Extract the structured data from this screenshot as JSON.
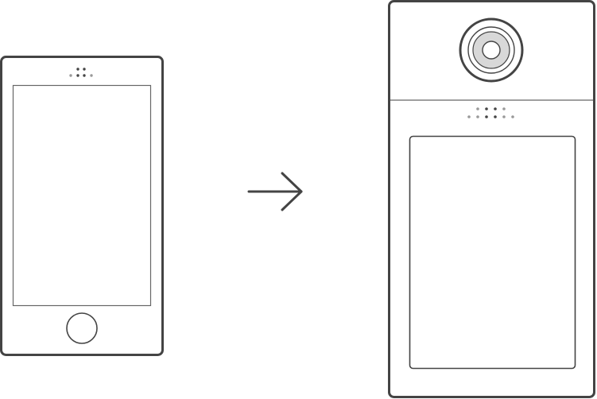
{
  "colors": {
    "background": "#ffffff",
    "outline_dark": "#444444",
    "outline_light": "#666666",
    "dot_dark": "#444444",
    "dot_light": "#999999",
    "lens_fill": "#d8d8d8"
  },
  "diagram": {
    "source_device": {
      "icon": "smartphone-icon",
      "parts": [
        "speaker-dots",
        "screen",
        "home-button"
      ]
    },
    "arrow": {
      "icon": "arrow-right-icon",
      "direction": "right"
    },
    "target_device": {
      "icon": "video-intercom-panel-icon",
      "parts": [
        "camera-lens",
        "divider",
        "speaker-dots",
        "display-screen"
      ]
    }
  }
}
